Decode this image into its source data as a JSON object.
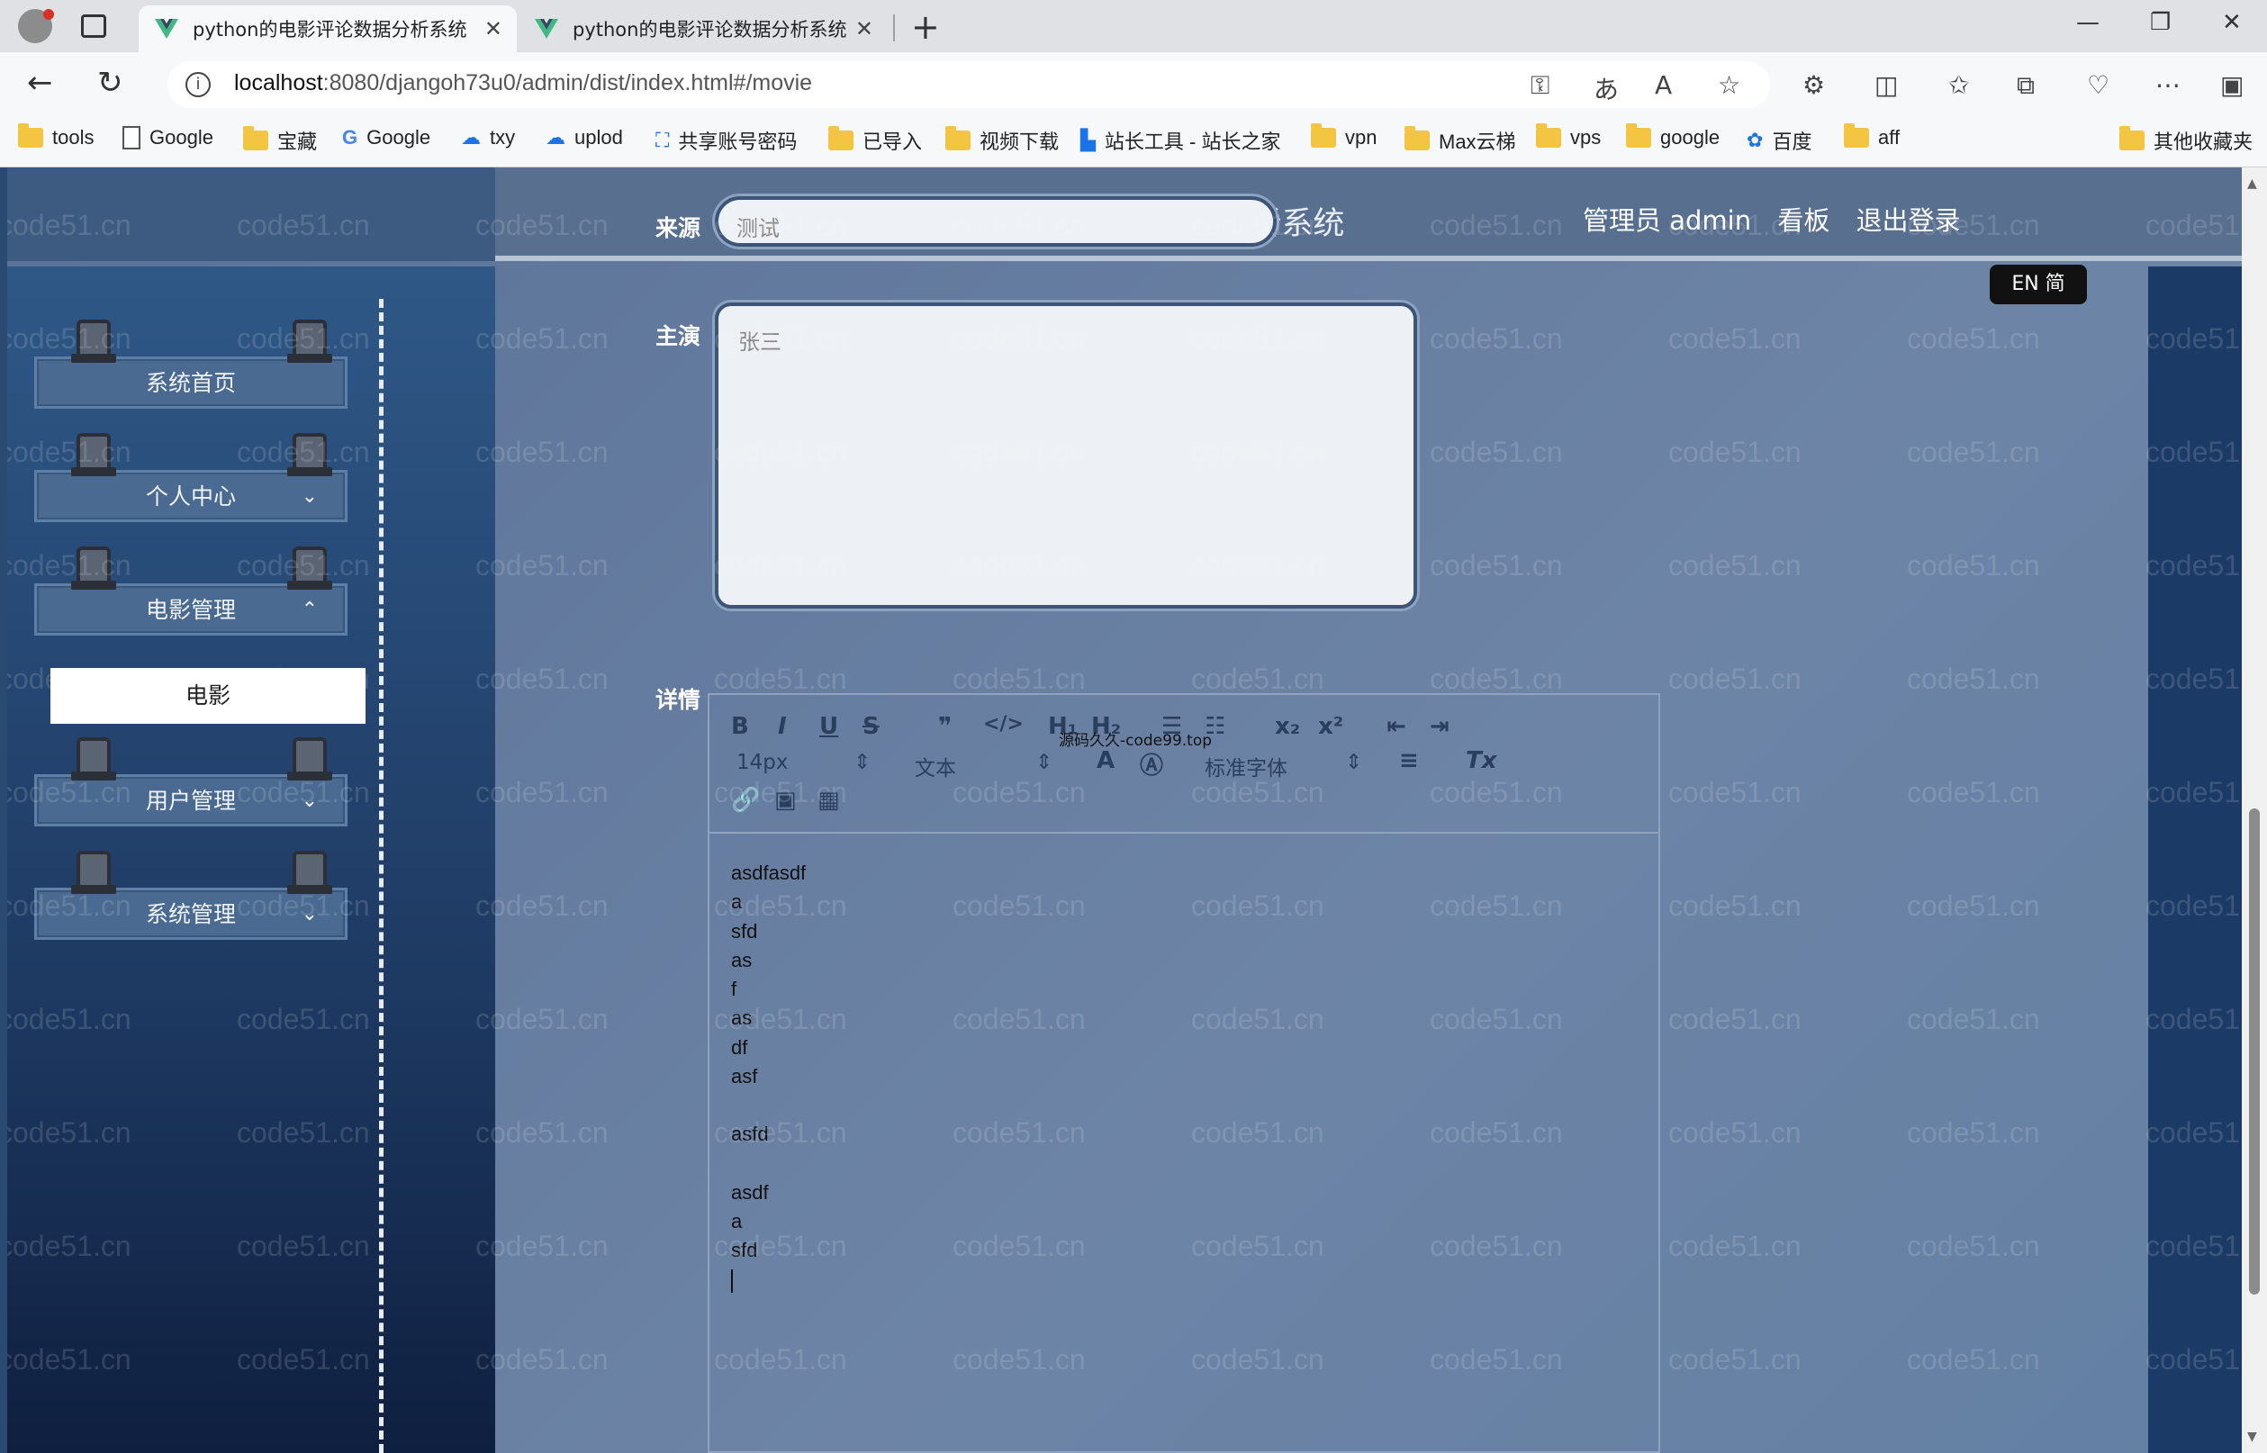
{
  "browser": {
    "tabs": [
      {
        "title": "python的电影评论数据分析系统",
        "active": true
      },
      {
        "title": "python的电影评论数据分析系统",
        "active": false
      }
    ],
    "url_host": "localhost",
    "url_rest": ":8080/djangoh73u0/admin/dist/index.html#/movie",
    "bookmarks": [
      {
        "label": "tools",
        "icon": "folder-icon"
      },
      {
        "label": "Google",
        "icon": "page-icon"
      },
      {
        "label": "宝藏",
        "icon": "folder-icon"
      },
      {
        "label": "Google",
        "icon": "google-icon"
      },
      {
        "label": "txy",
        "icon": "cloud-icon"
      },
      {
        "label": "uplod",
        "icon": "cloud-icon"
      },
      {
        "label": "共享账号密码",
        "icon": "app-icon"
      },
      {
        "label": "已导入",
        "icon": "folder-icon"
      },
      {
        "label": "视频下载",
        "icon": "folder-icon"
      },
      {
        "label": "站长工具 - 站长之家",
        "icon": "app-icon"
      },
      {
        "label": "vpn",
        "icon": "folder-icon"
      },
      {
        "label": "Max云梯",
        "icon": "folder-icon"
      },
      {
        "label": "vps",
        "icon": "folder-icon"
      },
      {
        "label": "google",
        "icon": "folder-icon"
      },
      {
        "label": "百度",
        "icon": "baidu-icon"
      },
      {
        "label": "aff",
        "icon": "folder-icon"
      }
    ],
    "other_bookmarks": "其他收藏夹"
  },
  "header": {
    "title": "python的电影评论数据分析系统",
    "user": "管理员 admin",
    "dashboard": "看板",
    "logout": "退出登录",
    "lang_toggle": "EN 简"
  },
  "sidebar": {
    "items": [
      {
        "label": "系统首页",
        "chevron": ""
      },
      {
        "label": "个人中心",
        "chevron": "down"
      },
      {
        "label": "电影管理",
        "chevron": "up"
      },
      {
        "label": "用户管理",
        "chevron": "down"
      },
      {
        "label": "系统管理",
        "chevron": "down"
      }
    ],
    "submenu": {
      "label": "电影"
    }
  },
  "form": {
    "source_label": "来源",
    "source_placeholder": "测试",
    "actor_label": "主演",
    "actor_placeholder": "张三",
    "detail_label": "详情"
  },
  "editor": {
    "font_size": "14px",
    "paragraph": "文本",
    "font_family": "标准字体",
    "toolbar_note": "源码久久-code99.top",
    "lines": [
      "asdfasdf",
      "a",
      "sfd",
      "as",
      "f",
      "as",
      "df",
      "asf",
      "",
      "asfd",
      "",
      "asdf",
      "a",
      "sfd"
    ]
  },
  "watermark": "code51.cn",
  "colors": {
    "sidebar_top": "#2f5887",
    "content_bg": "#6d84a6",
    "accent": "#3b5478"
  }
}
